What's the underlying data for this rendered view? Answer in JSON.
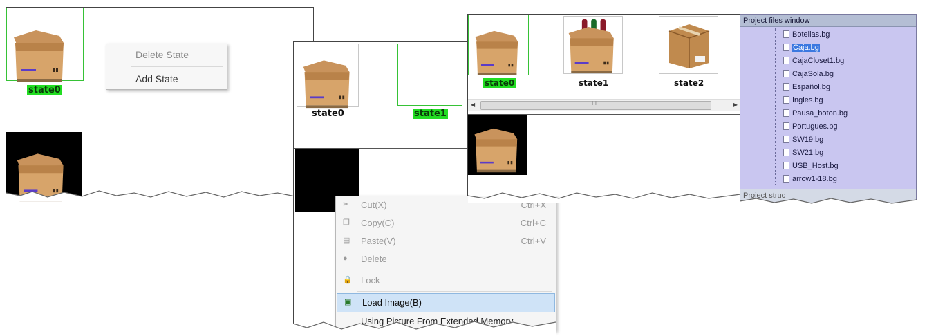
{
  "panel1": {
    "state0_label": "state0",
    "context_menu": {
      "items": [
        {
          "label": "Delete State"
        },
        {
          "label": "Add State"
        }
      ]
    }
  },
  "panel2": {
    "state0_label": "state0",
    "state1_label": "state1",
    "context_menu": {
      "items": [
        {
          "label": "Cut(X)",
          "shortcut": "Ctrl+X",
          "icon": "scissors-icon"
        },
        {
          "label": "Copy(C)",
          "shortcut": "Ctrl+C",
          "icon": "copy-icon"
        },
        {
          "label": "Paste(V)",
          "shortcut": "Ctrl+V",
          "icon": "paste-icon"
        },
        {
          "label": "Delete",
          "icon": "delete-icon"
        },
        {
          "label": "Lock",
          "icon": "lock-icon"
        },
        {
          "label": "Load Image(B)",
          "icon": "image-icon"
        },
        {
          "label": "Using Picture From Extended Memory"
        }
      ]
    }
  },
  "panel3": {
    "states": [
      {
        "label": "state0"
      },
      {
        "label": "state1"
      },
      {
        "label": "state2"
      }
    ],
    "scroll_glyph": "III",
    "project_files": {
      "title": "Project files window",
      "files": [
        "Botellas.bg",
        "Caja.bg",
        "CajaCloset1.bg",
        "CajaSola.bg",
        "Español.bg",
        "Ingles.bg",
        "Pausa_boton.bg",
        "Portugues.bg",
        "SW19.bg",
        "SW21.bg",
        "USB_Host.bg",
        "arrow1-18.bg"
      ],
      "selected": "Caja.bg",
      "footer": "Project struc"
    }
  },
  "colors": {
    "selected_green": "#22dd22",
    "tree_bg": "#c9c6f0",
    "tree_header": "#b4bed4",
    "highlight": "#cfe3f7"
  }
}
